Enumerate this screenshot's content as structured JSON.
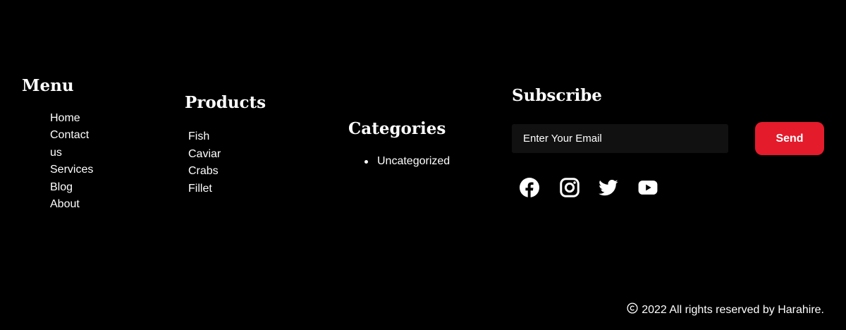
{
  "colors": {
    "background": "#000000",
    "text": "#ffffff",
    "input_background": "#111111",
    "accent": "#E41B2B"
  },
  "menu": {
    "heading": "Menu",
    "items": [
      "Home",
      "Contact",
      "us",
      "Services",
      "Blog",
      "About"
    ]
  },
  "products": {
    "heading": "Products",
    "items": [
      "Fish",
      "Caviar",
      "Crabs",
      "Fillet"
    ]
  },
  "categories": {
    "heading": "Categories",
    "items": [
      "Uncategorized"
    ]
  },
  "subscribe": {
    "heading": "Subscribe",
    "email_placeholder": "Enter Your Email",
    "email_value": "",
    "send_label": "Send"
  },
  "social": {
    "icons": [
      "facebook-icon",
      "instagram-icon",
      "twitter-icon",
      "youtube-icon"
    ]
  },
  "footer": {
    "copyright_icon": "copyright-icon",
    "copyright_text": "2022 All rights reserved by Harahire."
  }
}
